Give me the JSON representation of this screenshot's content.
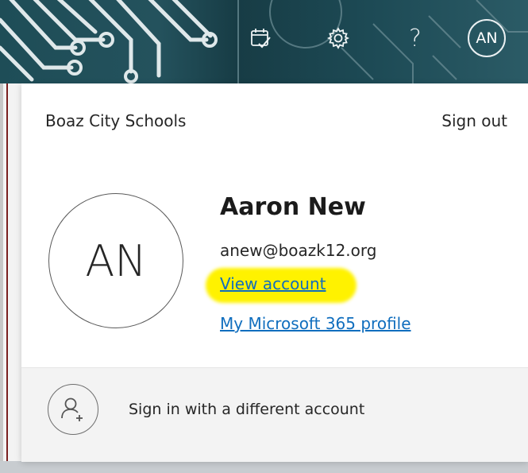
{
  "header": {
    "help_label": "?",
    "avatar_initials": "AN",
    "icons": [
      "calendar-check-icon",
      "gear-icon",
      "help-icon",
      "avatar"
    ]
  },
  "account": {
    "organization": "Boaz City Schools",
    "sign_out_label": "Sign out",
    "avatar_initials": "AN",
    "user_name": "Aaron New",
    "email": "anew@boazk12.org",
    "view_account_label": "View account",
    "profile_label": "My Microsoft 365 profile",
    "alt_sign_in_label": "Sign in with a different account"
  },
  "colors": {
    "link": "#106ebe",
    "highlight": "#fff200",
    "banner": "#1e4d57"
  }
}
